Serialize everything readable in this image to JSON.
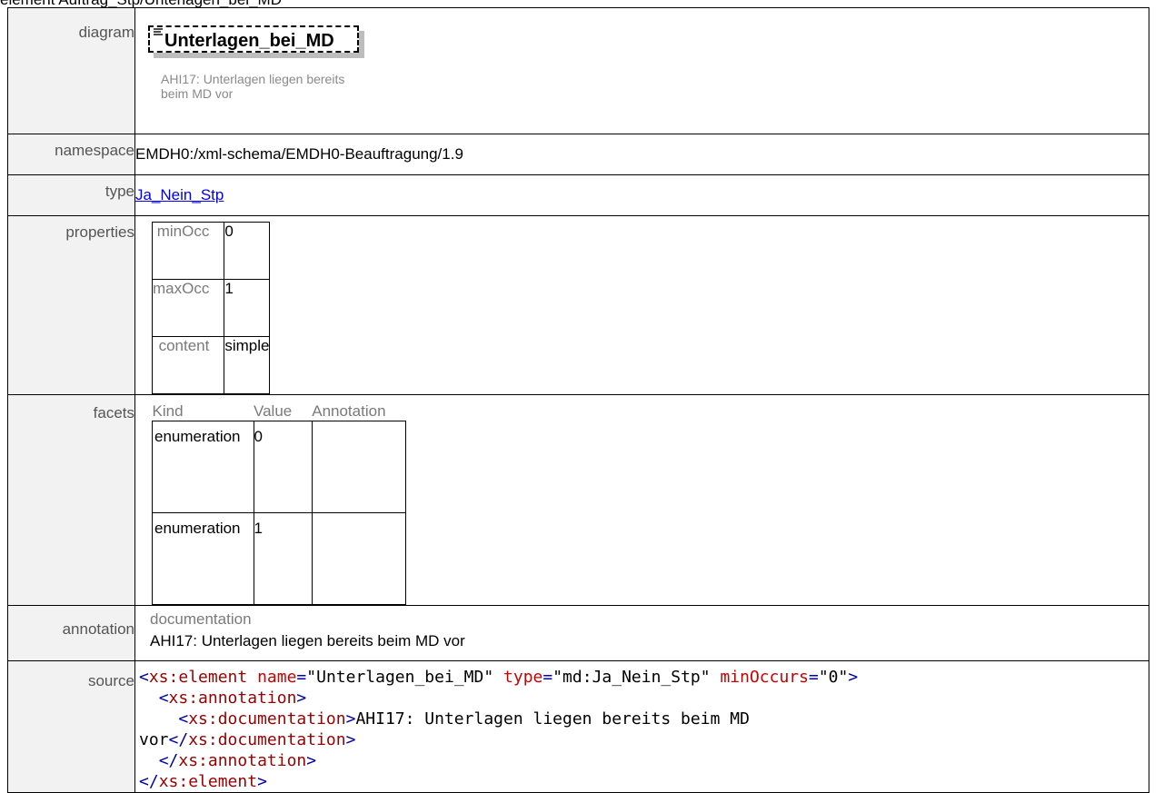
{
  "page_heading": "element Auftrag_Stp/Unterlagen_bei_MD",
  "labels": {
    "diagram": "diagram",
    "namespace": "namespace",
    "type": "type",
    "properties": "properties",
    "facets": "facets",
    "annotation": "annotation",
    "source": "source"
  },
  "diagram": {
    "element_name": "Unterlagen_bei_MD",
    "note": "AHI17: Unterlagen liegen bereits beim MD vor",
    "doc_icon": "documentation-lines-icon"
  },
  "namespace": "EMDH0:/xml-schema/EMDH0-Beauftragung/1.9",
  "type": {
    "link_text": "Ja_Nein_Stp"
  },
  "properties": [
    {
      "key": "minOcc",
      "value": "0"
    },
    {
      "key": "maxOcc",
      "value": "1"
    },
    {
      "key": "content",
      "value": "simple"
    }
  ],
  "facets": {
    "headers": [
      "Kind",
      "Value",
      "Annotation"
    ],
    "rows": [
      {
        "kind": "enumeration",
        "value": "0"
      },
      {
        "kind": "enumeration",
        "value": "1"
      }
    ]
  },
  "annotation": {
    "heading": "documentation",
    "text": "AHI17: Unterlagen liegen bereits beim MD vor"
  },
  "source": {
    "line1": {
      "open": "<",
      "tag": "xs:element",
      "sp1": " ",
      "a1n": "name",
      "eq": "=",
      "a1v": "\"Unterlagen_bei_MD\"",
      "a2n": "type",
      "a2v": "\"md:Ja_Nein_Stp\"",
      "a3n": "minOccurs",
      "a3v": "\"0\"",
      "close": ">"
    },
    "line2": {
      "indent": "  ",
      "open": "<",
      "tag": "xs:annotation",
      "close": ">"
    },
    "line3": {
      "indent": "    ",
      "open": "<",
      "tag": "xs:documentation",
      "close": ">",
      "text": "AHI17: Unterlagen liegen bereits beim MD"
    },
    "line4": {
      "text": "vor",
      "open": "</",
      "tag": "xs:documentation",
      "close": ">"
    },
    "line5": {
      "indent": "  ",
      "open": "</",
      "tag": "xs:annotation",
      "close": ">"
    },
    "line6": {
      "open": "</",
      "tag": "xs:element",
      "close": ">"
    }
  },
  "colors": {
    "label_bg": "#f2f2f2",
    "link": "#0000ee",
    "tag": "#990000",
    "attr_name": "#cc0000",
    "bracket": "#0000aa"
  }
}
